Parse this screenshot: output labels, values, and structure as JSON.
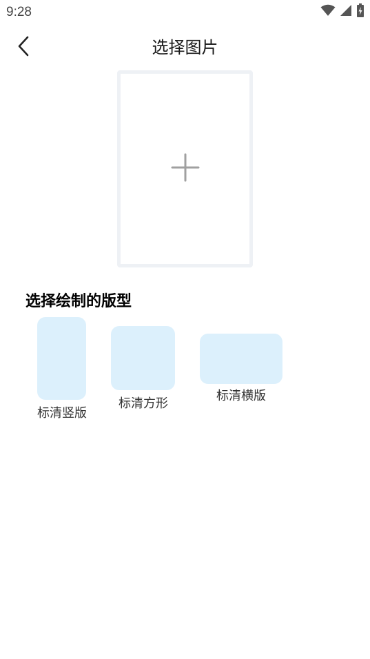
{
  "status_bar": {
    "time": "9:28",
    "icons": [
      "wifi-icon",
      "cell-signal-icon",
      "battery-charging-icon"
    ]
  },
  "header": {
    "back_icon": "chevron-left-icon",
    "title": "选择图片"
  },
  "image_picker": {
    "icon": "plus-icon"
  },
  "layout_section": {
    "title": "选择绘制的版型",
    "options": [
      {
        "label": "标清竖版"
      },
      {
        "label": "标清方形"
      },
      {
        "label": "标清横版"
      }
    ]
  },
  "colors": {
    "option_fill": "#dcf0fc",
    "picker_border": "#eef1f5",
    "plus_icon": "#a0a0a0"
  }
}
